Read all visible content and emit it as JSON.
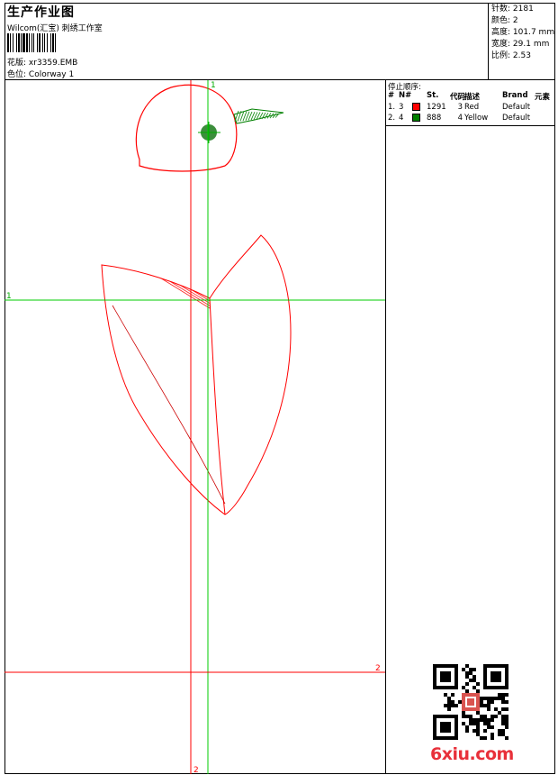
{
  "header": {
    "title": "生产作业图",
    "company": "Wilcom(汇宝) 刺绣工作室",
    "file_label": "花版:",
    "file_name": "xr3359.EMB",
    "colorway_label": "色位:",
    "colorway_name": "Colorway 1"
  },
  "info": {
    "stitches_label": "针数:",
    "stitches": "2181",
    "colors_label": "颜色:",
    "colors": "2",
    "height_label": "高度:",
    "height": "101.7 mm",
    "width_label": "宽度:",
    "width": "29.1 mm",
    "scale_label": "比例:",
    "scale": "2.53"
  },
  "stop_sequence": {
    "title": "停止顺序:",
    "columns": [
      "#",
      "N#",
      "",
      "St.",
      "代码",
      "描述",
      "Brand",
      "元素"
    ],
    "rows": [
      {
        "index": "1.",
        "n": "3",
        "color": "#ff0000",
        "stitches": "1291",
        "code": "3",
        "description": "Red",
        "brand": "Default",
        "element": ""
      },
      {
        "index": "2.",
        "n": "4",
        "color": "#008000",
        "stitches": "888",
        "code": "4",
        "description": "Yellow",
        "brand": "Default",
        "element": ""
      }
    ]
  },
  "guides": {
    "h1_label": "1",
    "h2_label": "2",
    "v1_label": "1",
    "v2_label": "2",
    "h1_color": "#00cc00",
    "h2_color": "#ff0000"
  },
  "watermark": {
    "brand": "6xiu.com"
  }
}
